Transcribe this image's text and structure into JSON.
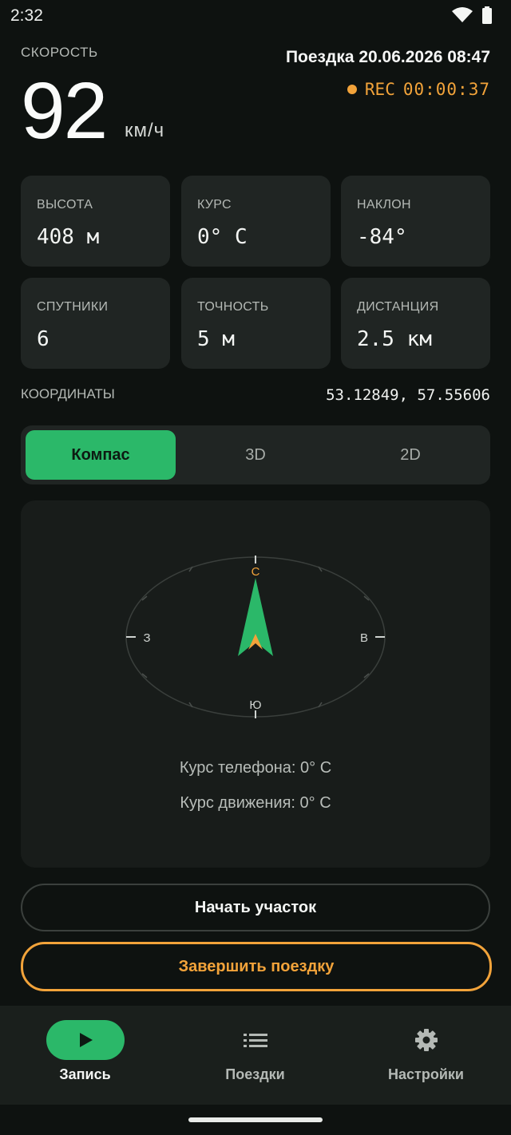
{
  "status_bar": {
    "time": "2:32",
    "wifi_icon": "wifi-icon",
    "battery_icon": "battery-icon"
  },
  "header": {
    "speed_label": "СКОРОСТЬ",
    "speed_value": "92",
    "speed_unit": "км/ч",
    "trip_title": "Поездка 20.06.2026 08:47",
    "rec_label": "REC",
    "rec_time": "00:00:37"
  },
  "stats": [
    {
      "label": "ВЫСОТА",
      "value": "408 м"
    },
    {
      "label": "КУРС",
      "value": "0° С"
    },
    {
      "label": "НАКЛОН",
      "value": "-84°"
    },
    {
      "label": "СПУТНИКИ",
      "value": "6"
    },
    {
      "label": "ТОЧНОСТЬ",
      "value": "5 м"
    },
    {
      "label": "ДИСТАНЦИЯ",
      "value": "2.5 км"
    }
  ],
  "coordinates": {
    "label": "КООРДИНАТЫ",
    "value": "53.12849, 57.55606"
  },
  "view_tabs": [
    {
      "label": "Компас",
      "active": true
    },
    {
      "label": "3D",
      "active": false
    },
    {
      "label": "2D",
      "active": false
    }
  ],
  "compass": {
    "north": "С",
    "east": "В",
    "south": "Ю",
    "west": "З",
    "phone_heading": "Курс телефона: 0° С",
    "movement_heading": "Курс движения: 0° С"
  },
  "actions": {
    "start_segment": "Начать участок",
    "finish_trip": "Завершить поездку"
  },
  "bottom_nav": [
    {
      "label": "Запись",
      "icon": "play-icon",
      "active": true
    },
    {
      "label": "Поездки",
      "icon": "list-icon",
      "active": false
    },
    {
      "label": "Настройки",
      "icon": "gear-icon",
      "active": false
    }
  ],
  "colors": {
    "accent_green": "#2bb869",
    "accent_orange": "#f2a33a",
    "background": "#0e1210",
    "card": "#202523"
  }
}
